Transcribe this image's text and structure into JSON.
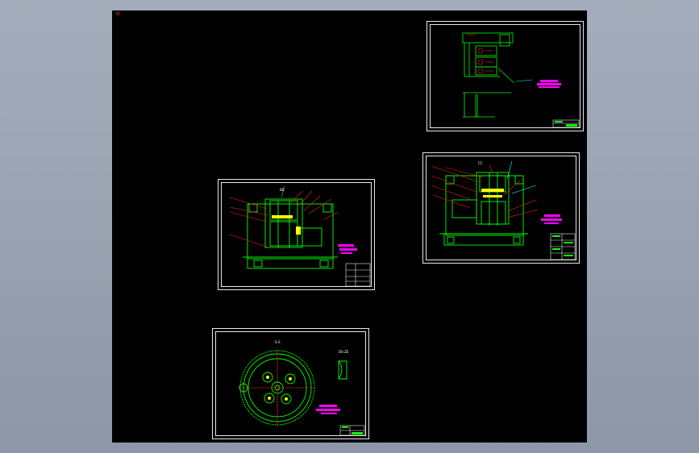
{
  "viewport": {
    "ucs_marker": "⊡",
    "colors": {
      "background_outer": "#97a1b0",
      "canvas": "#000000",
      "frame": "#e8e8e8",
      "geometry": "#00ff00",
      "leader": "#ff2020",
      "annotation": "#ff00ff",
      "highlight": "#ffff00",
      "accent": "#00ffff"
    }
  },
  "sheets": {
    "gear_view": {
      "section_label": "S-S",
      "detail_label": "DS-ZE"
    },
    "press_front": {
      "view_label": "BB"
    },
    "press_side": {
      "view_label": "CC"
    },
    "sketch": {}
  }
}
